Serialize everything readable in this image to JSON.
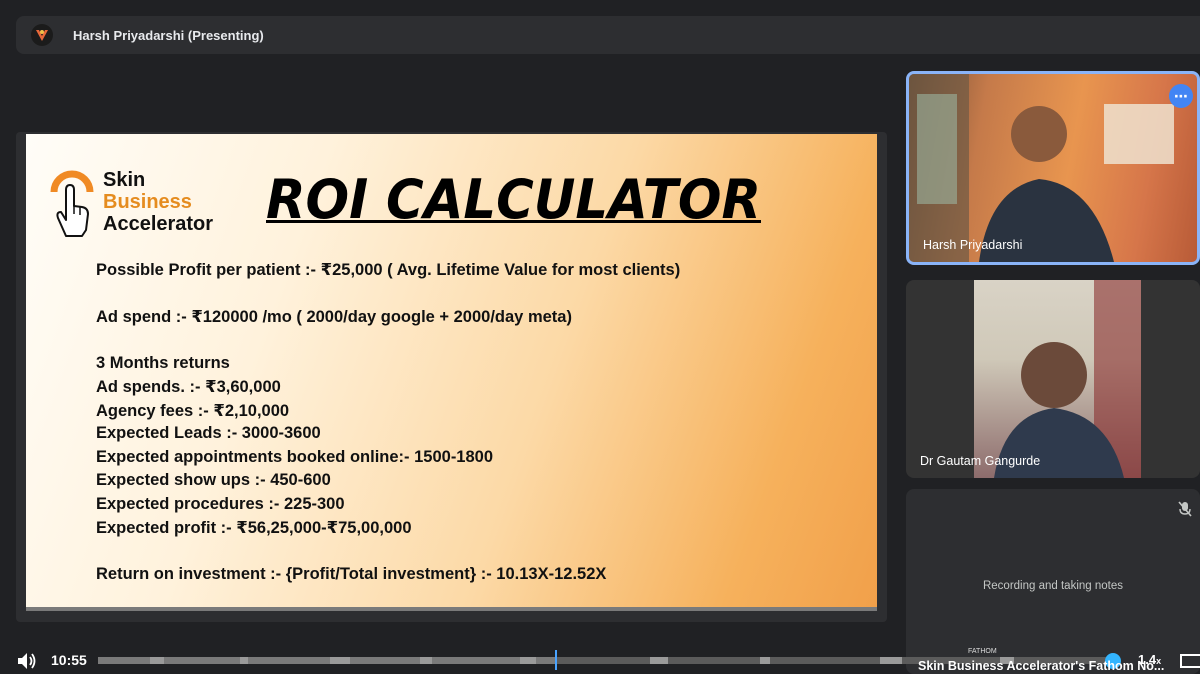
{
  "header": {
    "presenter_title": "Harsh Priyadarshi (Presenting)"
  },
  "slide": {
    "logo": {
      "line1": "Skin",
      "line2": "Business",
      "line3": "Accelerator"
    },
    "title": "ROI CALCULATOR",
    "lines": [
      "Possible Profit per patient :-  ₹25,000 ( Avg. Lifetime Value for most clients)",
      "Ad spend :-  ₹120000 /mo ( 2000/day google + 2000/day meta)",
      "3 Months returns",
      "Ad spends. :- ₹3,60,000",
      "Agency fees :- ₹2,10,000",
      "Expected Leads :- 3000-3600",
      "Expected appointments booked online:- 1500-1800",
      "Expected show ups :- 450-600",
      "Expected procedures :- 225-300",
      "Expected profit :- ₹56,25,000-₹75,00,000",
      "Return on investment :- {Profit/Total investment} :- 10.13X-12.52X"
    ]
  },
  "participants": [
    {
      "name": "Harsh Priyadarshi"
    },
    {
      "name": "Dr Gautam Gangurde"
    },
    {
      "status": "Recording and taking notes"
    }
  ],
  "player": {
    "current_time": "10:55",
    "speed": "1.4",
    "speed_suffix": "x",
    "caption": "Skin Business Accelerator's Fathom No...",
    "fathom_label": "FATHOM"
  }
}
